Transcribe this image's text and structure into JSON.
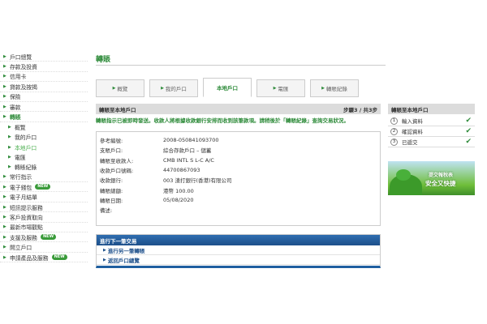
{
  "sidebar": {
    "items": [
      {
        "label": "戶口總覽",
        "type": "main"
      },
      {
        "label": "存款及投資",
        "type": "main"
      },
      {
        "label": "信用卡",
        "type": "main"
      },
      {
        "label": "貸款及按揭",
        "type": "main"
      },
      {
        "label": "保險",
        "type": "main"
      },
      {
        "label": "審款",
        "type": "main"
      },
      {
        "label": "轉賬",
        "type": "active"
      },
      {
        "label": "概覽",
        "type": "sub"
      },
      {
        "label": "我的戶口",
        "type": "sub"
      },
      {
        "label": "本地戶口",
        "type": "sub-current"
      },
      {
        "label": "電匯",
        "type": "sub"
      },
      {
        "label": "轉賬紀錄",
        "type": "sub"
      },
      {
        "label": "常行指示",
        "type": "main"
      },
      {
        "label": "電子錢包",
        "type": "main",
        "badge": "NEW"
      },
      {
        "label": "電子月結單",
        "type": "main"
      },
      {
        "label": "短訊提示服務",
        "type": "main"
      },
      {
        "label": "客戶投資取向",
        "type": "main"
      },
      {
        "label": "最新市場觀點",
        "type": "main"
      },
      {
        "label": "支援及服務",
        "type": "main",
        "badge": "NEW"
      },
      {
        "label": "開立戶口",
        "type": "main"
      },
      {
        "label": "申請產品及服務",
        "type": "main",
        "badge": "NEW"
      }
    ]
  },
  "main": {
    "title": "轉賬",
    "tabs": [
      {
        "label": "概覽",
        "active": false
      },
      {
        "label": "我的戶口",
        "active": false
      },
      {
        "label": "本地戶口",
        "active": true
      },
      {
        "label": "電匯",
        "active": false
      },
      {
        "label": "轉賬紀錄",
        "active": false
      }
    ],
    "box_title": "轉賬至本地戶口",
    "step_text": "步驟3 / 共3步",
    "notice": "轉賬指示已被即時發送。收款人將根據收款銀行安排而收到該筆款項。請稍後於「轉賬紀錄」查詢交易狀況。",
    "details": [
      {
        "label": "參考編號:",
        "value": "2008-050841093700"
      },
      {
        "label": "支賬戶口:",
        "value": "綜合存款戶口 – 儲蓄"
      },
      {
        "label": "轉賬至收款人:",
        "value": "CMB INTL S L-C A/C"
      },
      {
        "label": "收款戶口號碼:",
        "value": "44700867093"
      },
      {
        "label": "收款銀行:",
        "value": "003 渣打銀行(香港)有限公司"
      },
      {
        "label": "轉賬總額:",
        "value": "港幣   100.00"
      },
      {
        "label": "轉賬日期:",
        "value": "05/08/2020"
      },
      {
        "label": "備述:",
        "value": ""
      }
    ],
    "next": {
      "title": "進行下一筆交易",
      "links": [
        "進行另一筆轉賬",
        "返回戶口總覽"
      ]
    }
  },
  "right_panel": {
    "title": "轉賬至本地戶口",
    "steps": [
      {
        "num": "1",
        "label": "輸入資料"
      },
      {
        "num": "2",
        "label": "確認資料"
      },
      {
        "num": "3",
        "label": "已遞交"
      }
    ],
    "ad": {
      "line1": "提交報稅表",
      "line2": "安全又快捷"
    }
  },
  "colors": {
    "accent": "#2e8b3a",
    "link_blue": "#1d4f8a"
  }
}
